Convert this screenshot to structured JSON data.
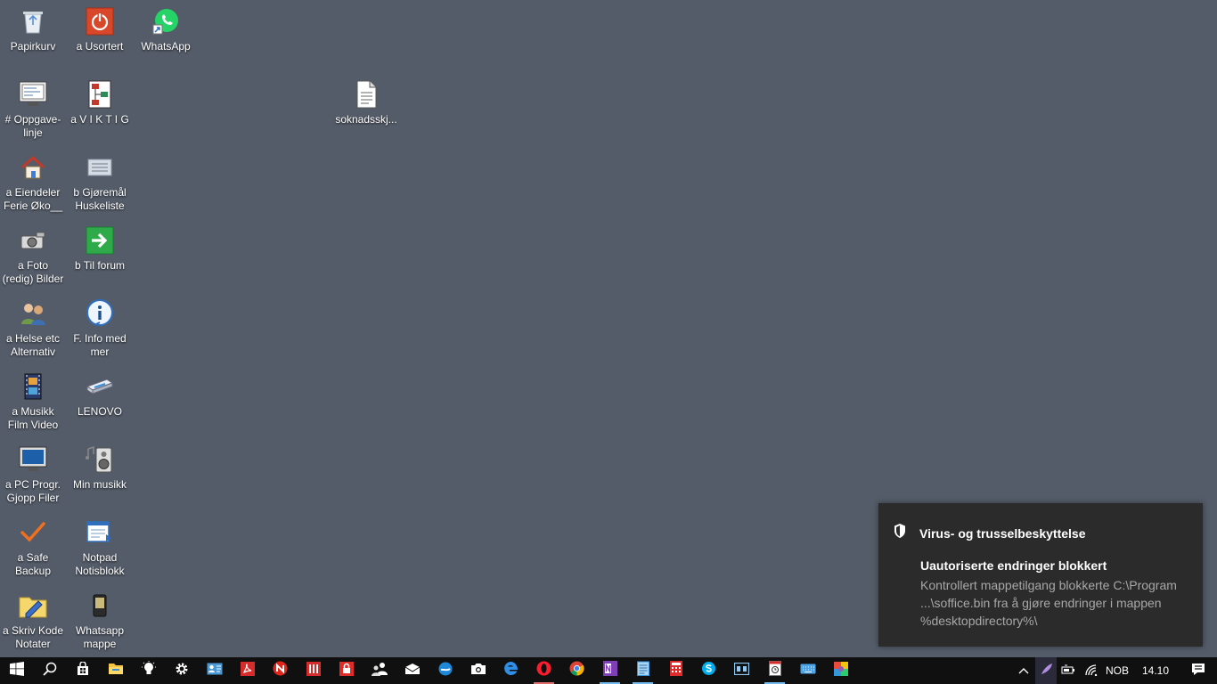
{
  "desktop": {
    "icons": [
      {
        "id": "papirkurv",
        "label": "Papirkurv",
        "icon": "recycle-bin-icon"
      },
      {
        "id": "usortert",
        "label": "a Usortert",
        "icon": "power-icon"
      },
      {
        "id": "whatsapp",
        "label": "WhatsApp",
        "icon": "whatsapp-icon"
      },
      {
        "id": "oppgavelinje",
        "label": "#  Oppgave-\nlinje",
        "icon": "monitor-list-icon"
      },
      {
        "id": "viktig",
        "label": "a V I K T I G",
        "icon": "org-chart-icon"
      },
      {
        "id": "soknad",
        "label": "soknadsskj...",
        "icon": "document-icon"
      },
      {
        "id": "eiendeler",
        "label": "a Eiendeler\nFerie Øko__",
        "icon": "house-icon"
      },
      {
        "id": "gjoremal",
        "label": "b Gjøremål\nHuskeliste",
        "icon": "list-icon"
      },
      {
        "id": "foto",
        "label": "a Foto\n(redig) Bilder",
        "icon": "camera-icon"
      },
      {
        "id": "tilforum",
        "label": "b Til forum",
        "icon": "green-arrow-icon"
      },
      {
        "id": "helse",
        "label": "a Helse etc\nAlternativ",
        "icon": "people-icon"
      },
      {
        "id": "info",
        "label": "F. Info med\nmer",
        "icon": "info-icon"
      },
      {
        "id": "musikk",
        "label": "a Musikk\nFilm  Video",
        "icon": "film-icon"
      },
      {
        "id": "lenovo",
        "label": "LENOVO",
        "icon": "network-drive-icon"
      },
      {
        "id": "pcprogr",
        "label": "a PC Progr.\nGjopp Filer",
        "icon": "monitor-icon"
      },
      {
        "id": "minmusikk",
        "label": "Min musikk",
        "icon": "speaker-icon"
      },
      {
        "id": "safebackup",
        "label": "a Safe\nBackup",
        "icon": "checkmark-icon"
      },
      {
        "id": "notpad",
        "label": "Notpad\nNotisblokk",
        "icon": "notepad-icon"
      },
      {
        "id": "skrivkode",
        "label": "a Skriv Kode\nNotater",
        "icon": "folder-pencil-icon"
      },
      {
        "id": "whatsappmappe",
        "label": "Whatsapp\nmappe",
        "icon": "phone-icon"
      }
    ]
  },
  "toast": {
    "app_name": "Virus- og trusselbeskyttelse",
    "title": "Uautoriserte endringer blokkert",
    "body": "Kontrollert mappetilgang blokkerte C:\\Program ...\\soffice.bin fra å gjøre endringer i mappen %desktopdirectory%\\",
    "icon": "shield-icon"
  },
  "taskbar": {
    "items": [
      {
        "name": "start",
        "icon": "windows-logo-icon"
      },
      {
        "name": "search",
        "icon": "search-icon"
      },
      {
        "name": "store",
        "icon": "store-icon"
      },
      {
        "name": "file-explorer",
        "icon": "folder-icon"
      },
      {
        "name": "tips",
        "icon": "lightbulb-icon"
      },
      {
        "name": "settings",
        "icon": "gear-icon"
      },
      {
        "name": "contacts",
        "icon": "contact-card-icon"
      },
      {
        "name": "acrobat",
        "icon": "pdf-icon"
      },
      {
        "name": "app-n",
        "icon": "n-logo-icon"
      },
      {
        "name": "app-bars",
        "icon": "bars-icon"
      },
      {
        "name": "lock-app",
        "icon": "lock-icon"
      },
      {
        "name": "people-app",
        "icon": "people-icon"
      },
      {
        "name": "mail",
        "icon": "mail-icon"
      },
      {
        "name": "app-blue",
        "icon": "blue-circle-icon"
      },
      {
        "name": "camera",
        "icon": "camera-icon"
      },
      {
        "name": "edge",
        "icon": "edge-icon"
      },
      {
        "name": "opera",
        "icon": "opera-icon"
      },
      {
        "name": "chrome",
        "icon": "chrome-icon"
      },
      {
        "name": "onenote",
        "icon": "onenote-icon"
      },
      {
        "name": "notepad",
        "icon": "notepad-icon"
      },
      {
        "name": "calculator",
        "icon": "calculator-icon"
      },
      {
        "name": "skype",
        "icon": "skype-icon"
      },
      {
        "name": "app-window",
        "icon": "window-icon"
      },
      {
        "name": "app-clock",
        "icon": "clock-app-icon"
      },
      {
        "name": "keyboard",
        "icon": "keyboard-icon"
      },
      {
        "name": "color-app",
        "icon": "color-grid-icon"
      }
    ],
    "tray": {
      "language": "NOB",
      "time": "14.10"
    }
  }
}
